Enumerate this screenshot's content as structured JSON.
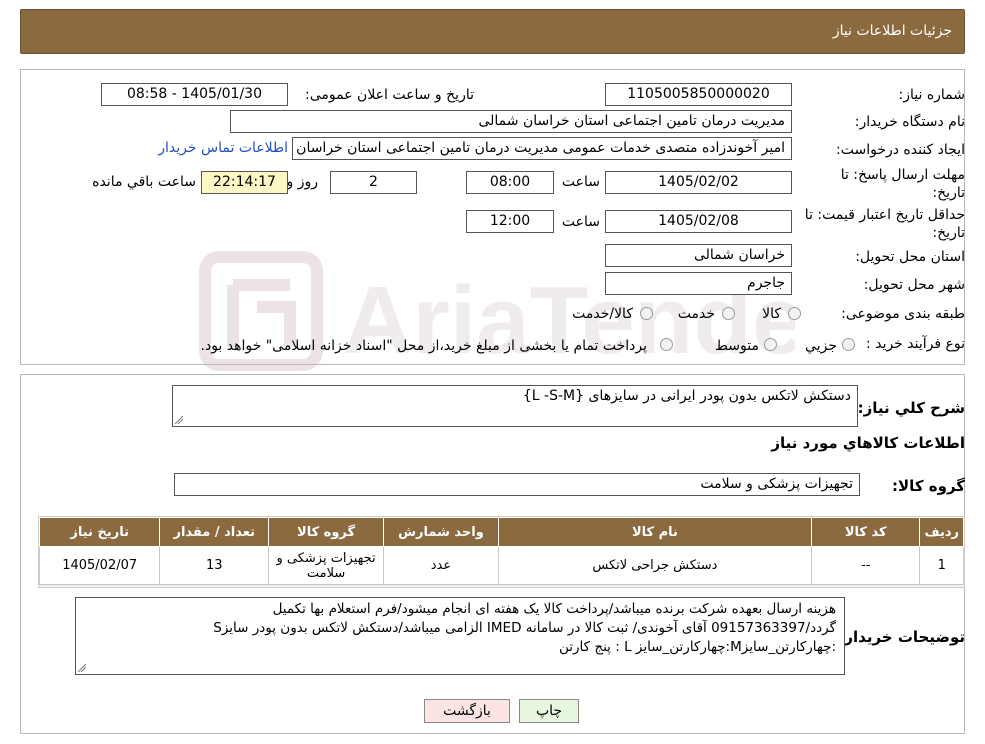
{
  "header": {
    "title": "جزئیات اطلاعات نیاز"
  },
  "form": {
    "need_number_label": "شماره نیاز:",
    "need_number": "1105005850000020",
    "announce_label": "تاریخ و ساعت اعلان عمومی:",
    "announce_value": "1405/01/30 - 08:58",
    "buyer_label": "نام دستگاه خریدار:",
    "buyer_value": "مدیریت درمان تامین اجتماعی استان خراسان شمالی",
    "requester_label": "ایجاد کننده درخواست:",
    "requester_value": "امیر آخوندزاده متصدی خدمات عمومی مدیریت درمان تامین اجتماعی استان خراسان",
    "contact_link": "اطلاعات تماس خریدار",
    "deadline_label_1": "مهلت ارسال پاسخ: تا",
    "deadline_label_2": "تاریخ:",
    "deadline_date": "1405/02/02",
    "time_label": "ساعت",
    "deadline_time": "08:00",
    "days_value": "2",
    "days_label": "روز و",
    "remaining_time": "22:14:17",
    "remaining_label": "ساعت باقي مانده",
    "validity_label_1": "حداقل تاریخ اعتبار قیمت: تا",
    "validity_label_2": "تاریخ:",
    "validity_date": "1405/02/08",
    "validity_time": "12:00",
    "province_label": "استان محل تحویل:",
    "province_value": "خراسان شمالی",
    "city_label": "شهر محل تحویل:",
    "city_value": "جاجرم",
    "category_label": "طبقه بندی موضوعی:",
    "category_options": [
      "کالا",
      "خدمت",
      "کالا/خدمت"
    ],
    "process_label": "نوع فرآیند خرید :",
    "process_options": [
      "جزیي",
      "متوسط"
    ],
    "process_note": "پرداخت تمام یا بخشی از مبلغ خرید،از محل \"اسناد خزانه اسلامی\" خواهد بود."
  },
  "summary": {
    "desc_label": "شرح کلي نياز:",
    "desc_value": "دستکش لاتکس بدون پودر ایرانی در سایزهای {L -S-M}",
    "goods_info_title": "اطلاعات کالاهاي مورد نياز",
    "group_label": "گروه کالا:",
    "group_value": "تجهیزات پزشکی و سلامت"
  },
  "table": {
    "headers": [
      "رديف",
      "کد کالا",
      "نام کالا",
      "واحد شمارش",
      "گروه کالا",
      "تعداد / مقدار",
      "تاریخ نیاز"
    ],
    "rows": [
      [
        "1",
        "--",
        "دستکش جراحی لاتکس",
        "عدد",
        "تجهیزات پزشکی و سلامت",
        "13",
        "1405/02/07"
      ]
    ]
  },
  "notes": {
    "label": "توضیحات خریدار:",
    "line1": "هزینه ارسال بعهده شرکت برنده میباشد/پرداخت کالا یک هفته ای انجام میشود/فرم استعلام بها تکمیل",
    "line2": "گردد/09157363397 آقای آخوندی/ ثبت کالا در سامانه IMED الزامی میباشد/دستکش لاتکس بدون پودر سایزS",
    "line3": ":چهارکارتن_سایزM:چهارکارتن_سایز L : پنج کارتن"
  },
  "buttons": {
    "print": "چاپ",
    "back": "بازگشت"
  },
  "colors": {
    "header": "#8a6a3e",
    "back_button": "#fde4e4",
    "print_button": "#e6f6df"
  }
}
